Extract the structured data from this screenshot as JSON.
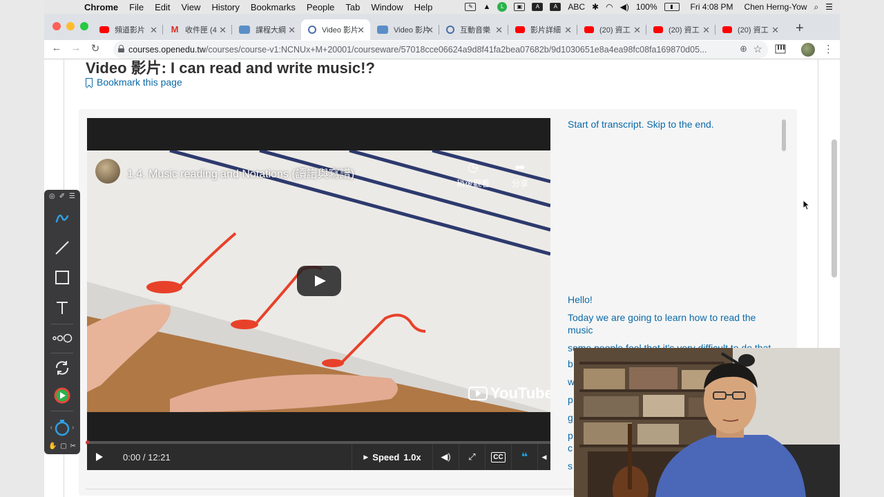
{
  "menubar": {
    "app": "Chrome",
    "items": [
      "File",
      "Edit",
      "View",
      "History",
      "Bookmarks",
      "People",
      "Tab",
      "Window",
      "Help"
    ],
    "battery": "100%",
    "clock": "Fri 4:08 PM",
    "user": "Chen Herng-Yow",
    "abc": "ABC"
  },
  "tabs": [
    {
      "label": "頻道影片",
      "icon": "youtube-icon"
    },
    {
      "label": "收件匣 (4",
      "icon": "gmail-icon"
    },
    {
      "label": "課程大綱",
      "icon": "openedu-icon"
    },
    {
      "label": "Video 影片",
      "icon": "globe-icon",
      "active": true
    },
    {
      "label": "Video 影片",
      "icon": "openedu-icon"
    },
    {
      "label": "互動音樂",
      "icon": "globe-icon"
    },
    {
      "label": "影片詳細",
      "icon": "youtube-icon"
    },
    {
      "label": "(20) 資工",
      "icon": "youtube-icon"
    },
    {
      "label": "(20) 資工",
      "icon": "youtube-icon"
    },
    {
      "label": "(20) 資工",
      "icon": "youtube-icon"
    }
  ],
  "address": {
    "host": "courses.openedu.tw",
    "path": "/courses/course-v1:NCNUx+M+20001/courseware/57018cce06624a9d8f41fa2bea07682b/9d1030651e8a4ea98fc08fa169870d05..."
  },
  "unit": {
    "title": "Video 影片: I can read and write music!?",
    "bookmark_label": "Bookmark this page"
  },
  "video": {
    "title": "1.4. Music reading and Notations (讀譜與寫譜)",
    "watch_later": "稍後觀看",
    "share": "分享",
    "brand": "YouTube",
    "time": "0:00 / 12:21",
    "speed_label": "Speed",
    "speed_value": "1.0x",
    "cc": "CC",
    "progress": 0
  },
  "transcript": {
    "skip": "Start of transcript. Skip to the end.",
    "lines": [
      "Hello!",
      "Today we are going to learn how to read the music",
      "some people feel that it's very difficult to do that"
    ],
    "line_starts": [
      "b",
      "w",
      "p",
      "g",
      "p",
      "c",
      "s"
    ]
  },
  "colors": {
    "link": "#0a6aa8",
    "player_bg": "#1e1e1e",
    "transcript_accent": "#1ea3e0",
    "annotation_bar": "#3a3a3c"
  }
}
